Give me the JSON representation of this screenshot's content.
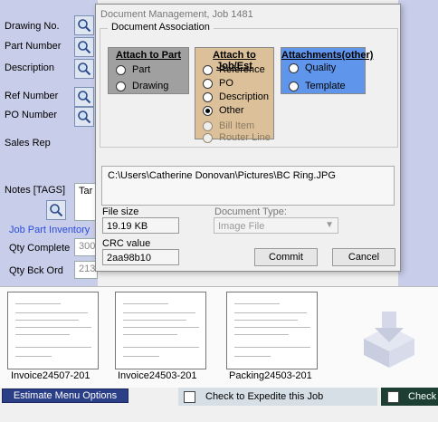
{
  "main": {
    "labels": {
      "drawing_no": "Drawing No.",
      "part_number": "Part Number",
      "description": "Description",
      "ref_number": "Ref Number",
      "po_number": "PO Number",
      "sales_rep": "Sales Rep",
      "notes_tags": "Notes [TAGS]"
    },
    "notes_value": "Tar",
    "job_part_inventory": "Job Part Inventory",
    "qty_complete_label": "Qty Complete",
    "qty_complete_value": "300",
    "qty_bck_ord_label": "Qty Bck Ord",
    "qty_bck_ord_value": "213"
  },
  "attachments": [
    {
      "label": "Invoice24507-201"
    },
    {
      "label": "Invoice24503-201"
    },
    {
      "label": "Packing24503-201"
    }
  ],
  "bottom": {
    "estimate_menu_options": "Estimate Menu Options",
    "check_expedite": "Check to Expedite this Job",
    "check2": "Check"
  },
  "dialog": {
    "title": "Document Management, Job 1481",
    "group_title": "Document Association",
    "attach_to_part": {
      "title": "Attach to Part",
      "color": "#a0a0a0",
      "options": [
        "Part",
        "Drawing"
      ]
    },
    "attach_to_job": {
      "title": "Attach to Job/Est",
      "color": "#dcc09a",
      "options": [
        "Reference",
        "PO",
        "Description",
        "Other"
      ],
      "selected": "Other",
      "disabled_options": [
        "Bill Item",
        "Router Line"
      ]
    },
    "attachments_other": {
      "title": "Attachments(other)",
      "color": "#5f95ea",
      "options": [
        "Quality",
        "Template"
      ]
    },
    "file_path": "C:\\Users\\Catherine Donovan\\Pictures\\BC Ring.JPG",
    "file_size_label": "File size",
    "file_size_value": "19.19 KB",
    "document_type_label": "Document Type:",
    "document_type_value": "Image File",
    "crc_label": "CRC value",
    "crc_value": "2aa98b10",
    "commit_label": "Commit",
    "cancel_label": "Cancel"
  }
}
